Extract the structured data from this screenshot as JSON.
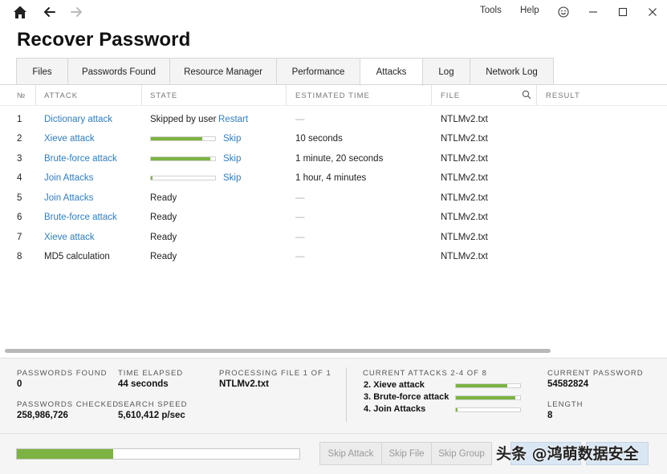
{
  "topbar": {
    "menu": {
      "tools": "Tools",
      "help": "Help"
    }
  },
  "page": {
    "title": "Recover Password"
  },
  "tabs": [
    {
      "label": "Files"
    },
    {
      "label": "Passwords Found"
    },
    {
      "label": "Resource Manager"
    },
    {
      "label": "Performance"
    },
    {
      "label": "Attacks"
    },
    {
      "label": "Log"
    },
    {
      "label": "Network Log"
    }
  ],
  "table": {
    "headers": {
      "num": "№",
      "attack": "ATTACK",
      "state": "STATE",
      "estimated": "ESTIMATED TIME",
      "file": "FILE",
      "result": "RESULT"
    },
    "rows": [
      {
        "num": "1",
        "attack": "Dictionary attack",
        "state": "Skipped by user",
        "action": "Restart",
        "estimated": "—",
        "file": "NTLMv2.txt"
      },
      {
        "num": "2",
        "attack": "Xieve attack",
        "progress": 0.8,
        "action": "Skip",
        "estimated": "10 seconds",
        "file": "NTLMv2.txt"
      },
      {
        "num": "3",
        "attack": "Brute-force attack",
        "progress": 0.93,
        "action": "Skip",
        "estimated": "1 minute, 20 seconds",
        "file": "NTLMv2.txt"
      },
      {
        "num": "4",
        "attack": "Join Attacks",
        "progress": 0.02,
        "action": "Skip",
        "estimated": "1 hour, 4 minutes",
        "file": "NTLMv2.txt"
      },
      {
        "num": "5",
        "attack": "Join Attacks",
        "state": "Ready",
        "estimated": "—",
        "file": "NTLMv2.txt"
      },
      {
        "num": "6",
        "attack": "Brute-force attack",
        "state": "Ready",
        "estimated": "—",
        "file": "NTLMv2.txt"
      },
      {
        "num": "7",
        "attack": "Xieve attack",
        "state": "Ready",
        "estimated": "—",
        "file": "NTLMv2.txt"
      },
      {
        "num": "8",
        "attack": "MD5 calculation",
        "state": "Ready",
        "estimated": "—",
        "file": "NTLMv2.txt"
      }
    ]
  },
  "stats": {
    "passwords_found_label": "PASSWORDS FOUND",
    "passwords_found": "0",
    "time_elapsed_label": "TIME ELAPSED",
    "time_elapsed": "44 seconds",
    "processing_label": "PROCESSING FILE 1 OF 1",
    "processing_file": "NTLMv2.txt",
    "passwords_checked_label": "PASSWORDS CHECKED",
    "passwords_checked": "258,986,726",
    "search_speed_label": "SEARCH SPEED",
    "search_speed": "5,610,412 p/sec",
    "current_attacks_label": "CURRENT ATTACKS 2-4 OF 8",
    "current_attacks": [
      {
        "label": "2. Xieve attack",
        "progress": 0.8
      },
      {
        "label": "3. Brute-force attack",
        "progress": 0.93
      },
      {
        "label": "4. Join Attacks",
        "progress": 0.02
      }
    ],
    "current_password_label": "CURRENT PASSWORD",
    "current_password": "54582824",
    "length_label": "LENGTH",
    "length": "8"
  },
  "overall_progress": 0.34,
  "buttons": {
    "skip_attack": "Skip Attack",
    "skip_file": "Skip File",
    "skip_group": "Skip Group"
  },
  "watermark": "头条 @鸿萌数据安全",
  "colors": {
    "accent": "#7cb342",
    "link": "#2f7dc2"
  }
}
